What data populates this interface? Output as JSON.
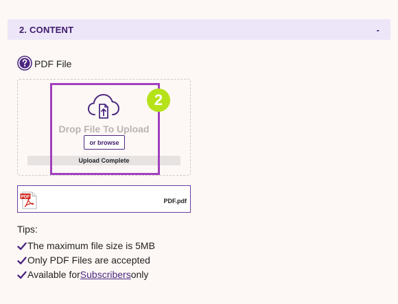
{
  "section": {
    "title": "2. CONTENT",
    "toggle": "-"
  },
  "field": {
    "label": "PDF File",
    "help_icon": "question-circle-icon"
  },
  "upload": {
    "drop_text": "Drop File To Upload",
    "browse_label": "or browse",
    "status": "Upload Complete",
    "progress": 1.0,
    "cloud_icon": "cloud-upload-icon"
  },
  "annotation": {
    "step": "2",
    "highlight_color": "#a13fbe",
    "badge_color": "#b6e21a"
  },
  "file": {
    "name": "PDF.pdf",
    "icon": "pdf-file-icon"
  },
  "tips": {
    "title": "Tips:",
    "items": [
      {
        "text": "The maximum file size is 5MB"
      },
      {
        "text": "Only PDF Files are accepted"
      },
      {
        "prefix": "Available for ",
        "link": "Subscribers",
        "suffix": " only"
      }
    ]
  },
  "colors": {
    "accent": "#4b2680",
    "header_bg": "#ede6f8",
    "page_bg": "#fdf8f5"
  }
}
